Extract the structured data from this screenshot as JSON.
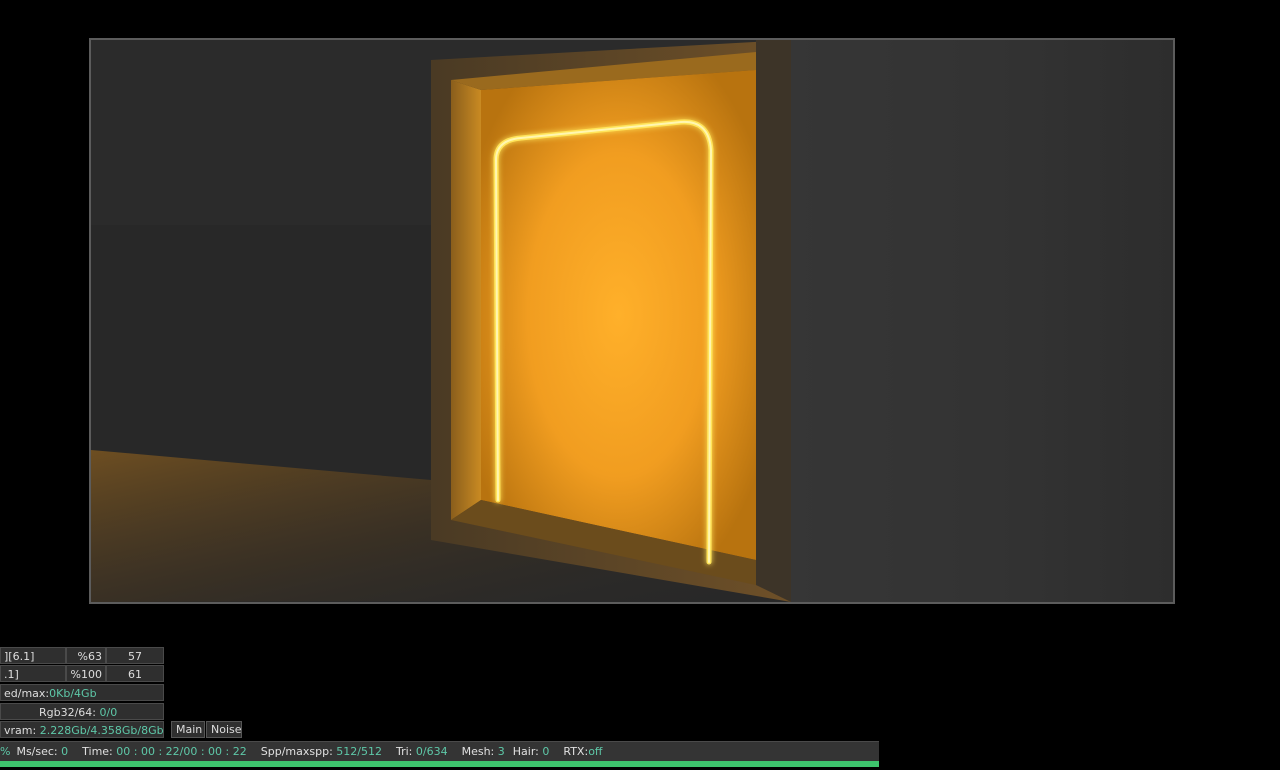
{
  "stats": {
    "row1": {
      "col1": "][6.1]",
      "col2": "%63",
      "col3": "57"
    },
    "row2": {
      "col1": ".1]",
      "col2": "%100",
      "col3": "61"
    },
    "row3": {
      "label": "ed/max:",
      "value": "0Kb/4Gb"
    },
    "row4": {
      "label": "Rgb32/64: ",
      "value": "0/0"
    },
    "row5": {
      "label": " vram: ",
      "value": "2.228Gb/4.358Gb/8Gb"
    }
  },
  "buttons": {
    "main": "Main",
    "noise": "Noise"
  },
  "status": {
    "pct": "%",
    "ms_label": "Ms/sec: ",
    "ms_value": "0",
    "time_label": "Time: ",
    "time_value": "00 : 00 : 22/00 : 00 : 22",
    "spp_label": "Spp/maxspp: ",
    "spp_value": "512/512",
    "tri_label": "Tri: ",
    "tri_value": "0/634",
    "mesh_label": "Mesh: ",
    "mesh_value": "3",
    "hair_label": "Hair: ",
    "hair_value": "0",
    "rtx_label": "RTX:",
    "rtx_value": "off"
  },
  "progress": {
    "fraction": 1.0
  },
  "colors": {
    "accent_value": "#5ec8a8",
    "progress": "#3ec46d",
    "neon": "#ffe45a",
    "glow": "#f5a623"
  }
}
